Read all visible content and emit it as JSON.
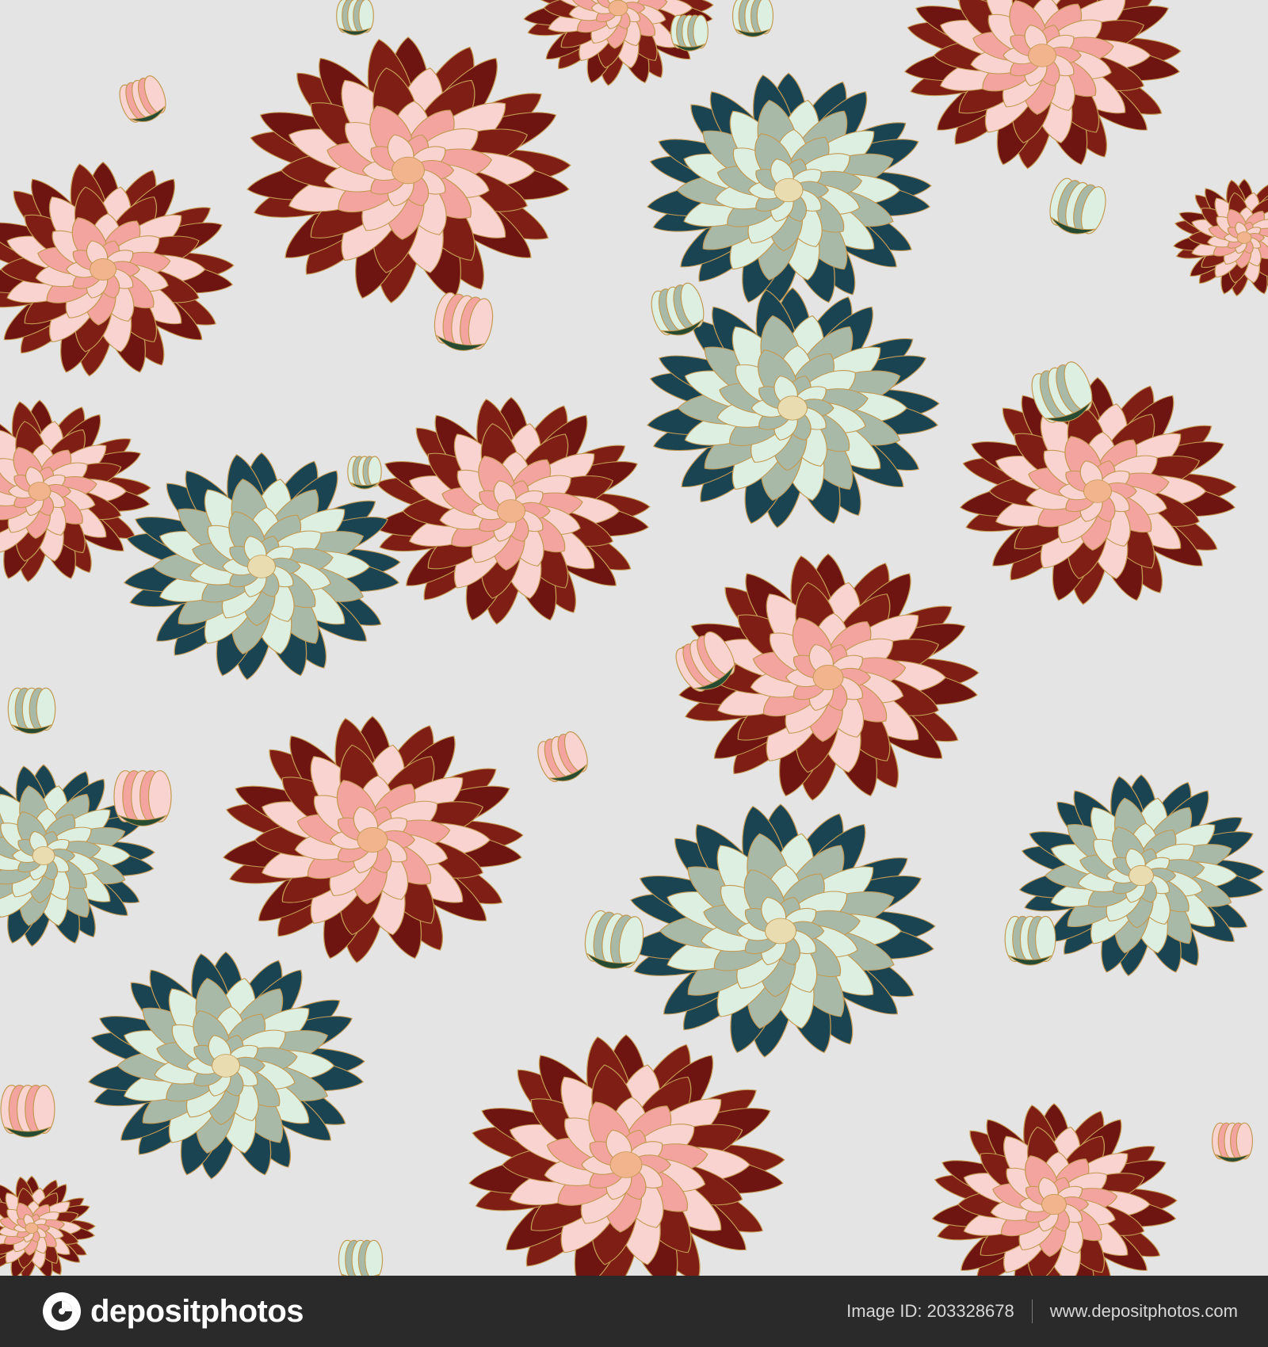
{
  "image": {
    "background_color": "#e4e4e4",
    "subject": "seamless pattern of chrysanthemum flowers and buds",
    "palette": {
      "red_dark": "#6e1512",
      "red_mid": "#7e1e14",
      "pink_light": "#f9d3d0",
      "pink_mid": "#f3a49f",
      "teal_dark": "#1b4452",
      "mint_light": "#dcefe0",
      "sage": "#a8b9a8",
      "gold_outline": "#c49a52"
    }
  },
  "footer": {
    "brand": "depositphotos",
    "image_id": "Image ID: 203328678",
    "website": "www.depositphotos.com",
    "background_color": "#2a2a2a"
  }
}
